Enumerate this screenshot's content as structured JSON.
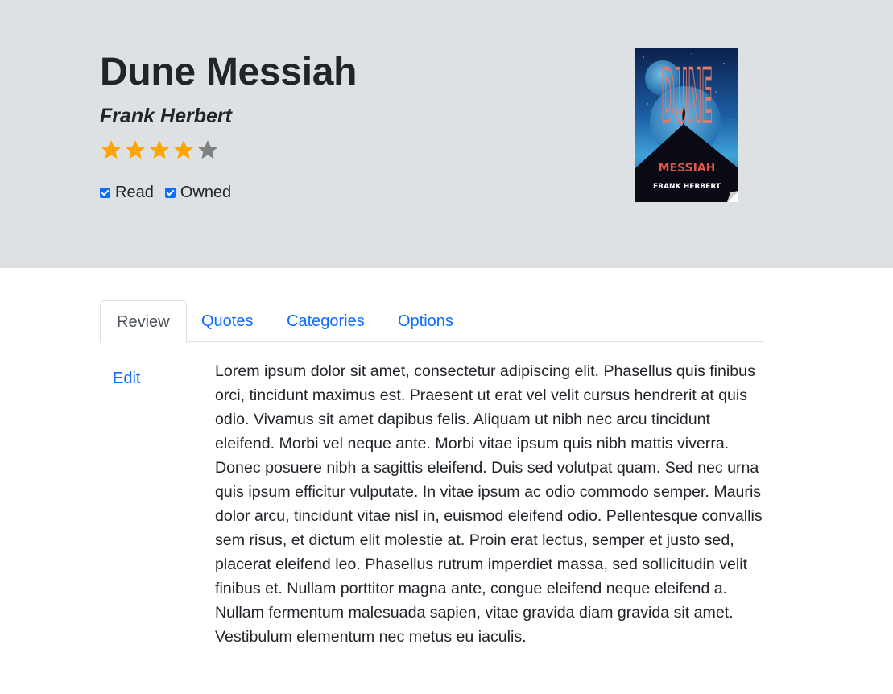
{
  "book": {
    "title": "Dune Messiah",
    "author": "Frank Herbert",
    "rating": 4,
    "rating_max": 5,
    "read_label": "Read",
    "read_checked": true,
    "owned_label": "Owned",
    "owned_checked": true,
    "cover": {
      "title_text": "DUNE",
      "subtitle_text": "MESSIAH",
      "author_text": "FRANK HERBERT"
    }
  },
  "tabs": [
    {
      "label": "Review",
      "active": true
    },
    {
      "label": "Quotes",
      "active": false
    },
    {
      "label": "Categories",
      "active": false
    },
    {
      "label": "Options",
      "active": false
    }
  ],
  "review": {
    "edit_label": "Edit",
    "text": "Lorem ipsum dolor sit amet, consectetur adipiscing elit. Phasellus quis finibus orci, tincidunt maximus est. Praesent ut erat vel velit cursus hendrerit at quis odio. Vivamus sit amet dapibus felis. Aliquam ut nibh nec arcu tincidunt eleifend. Morbi vel neque ante. Morbi vitae ipsum quis nibh mattis viverra. Donec posuere nibh a sagittis eleifend. Duis sed volutpat quam. Sed nec urna quis ipsum efficitur vulputate. In vitae ipsum ac odio commodo semper. Mauris dolor arcu, tincidunt vitae nisl in, euismod eleifend odio. Pellentesque convallis sem risus, et dictum elit molestie at. Proin erat lectus, semper et justo sed, placerat eleifend leo. Phasellus rutrum imperdiet massa, sed sollicitudin velit finibus et. Nullam porttitor magna ante, congue eleifend neque eleifend a. Nullam fermentum malesuada sapien, vitae gravida diam gravida sit amet. Vestibulum elementum nec metus eu iaculis."
  },
  "colors": {
    "hero_bg": "#dde1e4",
    "star_filled": "#ffa500",
    "star_empty": "#808080",
    "link": "#0d6efd",
    "checkbox": "#0d6efd"
  },
  "icons": {
    "star": "star-icon",
    "checkbox": "checkbox-checked-icon"
  }
}
